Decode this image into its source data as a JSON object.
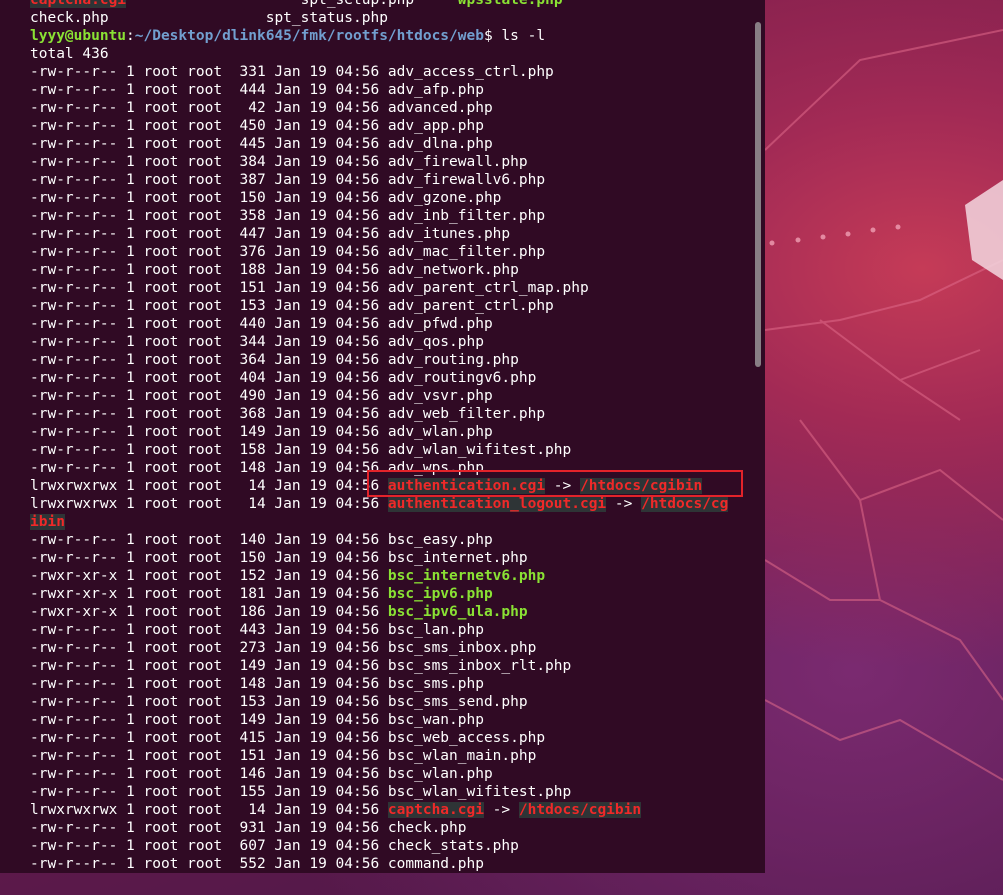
{
  "terminal": {
    "prev_row1": [
      "captcha.cgi",
      "spt_setup.php",
      "wpsstate.php"
    ],
    "prev_row2": [
      "check.php",
      "spt_status.php"
    ],
    "prompt": {
      "user": "lyyy@ubuntu",
      "sep": ":",
      "path": "~/Desktop/dlink645/fmk/rootfs/htdocs/web",
      "cmd": "$ ls -l"
    },
    "total": "total 436",
    "entries": [
      {
        "meta": "-rw-r--r-- 1 root root  331 Jan 19 04:56 ",
        "name": "adv_access_ctrl.php",
        "kind": "file"
      },
      {
        "meta": "-rw-r--r-- 1 root root  444 Jan 19 04:56 ",
        "name": "adv_afp.php",
        "kind": "file"
      },
      {
        "meta": "-rw-r--r-- 1 root root   42 Jan 19 04:56 ",
        "name": "advanced.php",
        "kind": "file"
      },
      {
        "meta": "-rw-r--r-- 1 root root  450 Jan 19 04:56 ",
        "name": "adv_app.php",
        "kind": "file"
      },
      {
        "meta": "-rw-r--r-- 1 root root  445 Jan 19 04:56 ",
        "name": "adv_dlna.php",
        "kind": "file"
      },
      {
        "meta": "-rw-r--r-- 1 root root  384 Jan 19 04:56 ",
        "name": "adv_firewall.php",
        "kind": "file"
      },
      {
        "meta": "-rw-r--r-- 1 root root  387 Jan 19 04:56 ",
        "name": "adv_firewallv6.php",
        "kind": "file"
      },
      {
        "meta": "-rw-r--r-- 1 root root  150 Jan 19 04:56 ",
        "name": "adv_gzone.php",
        "kind": "file"
      },
      {
        "meta": "-rw-r--r-- 1 root root  358 Jan 19 04:56 ",
        "name": "adv_inb_filter.php",
        "kind": "file"
      },
      {
        "meta": "-rw-r--r-- 1 root root  447 Jan 19 04:56 ",
        "name": "adv_itunes.php",
        "kind": "file"
      },
      {
        "meta": "-rw-r--r-- 1 root root  376 Jan 19 04:56 ",
        "name": "adv_mac_filter.php",
        "kind": "file"
      },
      {
        "meta": "-rw-r--r-- 1 root root  188 Jan 19 04:56 ",
        "name": "adv_network.php",
        "kind": "file"
      },
      {
        "meta": "-rw-r--r-- 1 root root  151 Jan 19 04:56 ",
        "name": "adv_parent_ctrl_map.php",
        "kind": "file"
      },
      {
        "meta": "-rw-r--r-- 1 root root  153 Jan 19 04:56 ",
        "name": "adv_parent_ctrl.php",
        "kind": "file"
      },
      {
        "meta": "-rw-r--r-- 1 root root  440 Jan 19 04:56 ",
        "name": "adv_pfwd.php",
        "kind": "file"
      },
      {
        "meta": "-rw-r--r-- 1 root root  344 Jan 19 04:56 ",
        "name": "adv_qos.php",
        "kind": "file"
      },
      {
        "meta": "-rw-r--r-- 1 root root  364 Jan 19 04:56 ",
        "name": "adv_routing.php",
        "kind": "file"
      },
      {
        "meta": "-rw-r--r-- 1 root root  404 Jan 19 04:56 ",
        "name": "adv_routingv6.php",
        "kind": "file"
      },
      {
        "meta": "-rw-r--r-- 1 root root  490 Jan 19 04:56 ",
        "name": "adv_vsvr.php",
        "kind": "file"
      },
      {
        "meta": "-rw-r--r-- 1 root root  368 Jan 19 04:56 ",
        "name": "adv_web_filter.php",
        "kind": "file"
      },
      {
        "meta": "-rw-r--r-- 1 root root  149 Jan 19 04:56 ",
        "name": "adv_wlan.php",
        "kind": "file"
      },
      {
        "meta": "-rw-r--r-- 1 root root  158 Jan 19 04:56 ",
        "name": "adv_wlan_wifitest.php",
        "kind": "file"
      },
      {
        "meta": "-rw-r--r-- 1 root root  148 Jan 19 04:56 ",
        "name": "adv_wps.php",
        "kind": "file"
      },
      {
        "meta": "lrwxrwxrwx 1 root root   14 Jan 19 04:56 ",
        "name": "authentication.cgi",
        "kind": "link",
        "target": "/htdocs/cgibin"
      },
      {
        "meta": "lrwxrwxrwx 1 root root   14 Jan 19 04:56 ",
        "name": "authentication_logout.cgi",
        "kind": "link",
        "target": "/htdocs/cgibin"
      },
      {
        "meta": "-rw-r--r-- 1 root root  140 Jan 19 04:56 ",
        "name": "bsc_easy.php",
        "kind": "file"
      },
      {
        "meta": "-rw-r--r-- 1 root root  150 Jan 19 04:56 ",
        "name": "bsc_internet.php",
        "kind": "file"
      },
      {
        "meta": "-rwxr-xr-x 1 root root  152 Jan 19 04:56 ",
        "name": "bsc_internetv6.php",
        "kind": "exe"
      },
      {
        "meta": "-rwxr-xr-x 1 root root  181 Jan 19 04:56 ",
        "name": "bsc_ipv6.php",
        "kind": "exe"
      },
      {
        "meta": "-rwxr-xr-x 1 root root  186 Jan 19 04:56 ",
        "name": "bsc_ipv6_ula.php",
        "kind": "exe"
      },
      {
        "meta": "-rw-r--r-- 1 root root  443 Jan 19 04:56 ",
        "name": "bsc_lan.php",
        "kind": "file"
      },
      {
        "meta": "-rw-r--r-- 1 root root  273 Jan 19 04:56 ",
        "name": "bsc_sms_inbox.php",
        "kind": "file"
      },
      {
        "meta": "-rw-r--r-- 1 root root  149 Jan 19 04:56 ",
        "name": "bsc_sms_inbox_rlt.php",
        "kind": "file"
      },
      {
        "meta": "-rw-r--r-- 1 root root  148 Jan 19 04:56 ",
        "name": "bsc_sms.php",
        "kind": "file"
      },
      {
        "meta": "-rw-r--r-- 1 root root  153 Jan 19 04:56 ",
        "name": "bsc_sms_send.php",
        "kind": "file"
      },
      {
        "meta": "-rw-r--r-- 1 root root  149 Jan 19 04:56 ",
        "name": "bsc_wan.php",
        "kind": "file"
      },
      {
        "meta": "-rw-r--r-- 1 root root  415 Jan 19 04:56 ",
        "name": "bsc_web_access.php",
        "kind": "file"
      },
      {
        "meta": "-rw-r--r-- 1 root root  151 Jan 19 04:56 ",
        "name": "bsc_wlan_main.php",
        "kind": "file"
      },
      {
        "meta": "-rw-r--r-- 1 root root  146 Jan 19 04:56 ",
        "name": "bsc_wlan.php",
        "kind": "file"
      },
      {
        "meta": "-rw-r--r-- 1 root root  155 Jan 19 04:56 ",
        "name": "bsc_wlan_wifitest.php",
        "kind": "file"
      },
      {
        "meta": "lrwxrwxrwx 1 root root   14 Jan 19 04:56 ",
        "name": "captcha.cgi",
        "kind": "link",
        "target": "/htdocs/cgibin"
      },
      {
        "meta": "-rw-r--r-- 1 root root  931 Jan 19 04:56 ",
        "name": "check.php",
        "kind": "file"
      },
      {
        "meta": "-rw-r--r-- 1 root root  607 Jan 19 04:56 ",
        "name": "check_stats.php",
        "kind": "file"
      },
      {
        "meta": "-rw-r--r-- 1 root root  552 Jan 19 04:56 ",
        "name": "command.php",
        "kind": "file"
      }
    ]
  },
  "colors": {
    "terminal_bg": "#300a24",
    "prompt_user": "#8ae234",
    "prompt_path": "#729fcf",
    "broken_link": "#ef2929",
    "highlight": "#e3232a"
  }
}
